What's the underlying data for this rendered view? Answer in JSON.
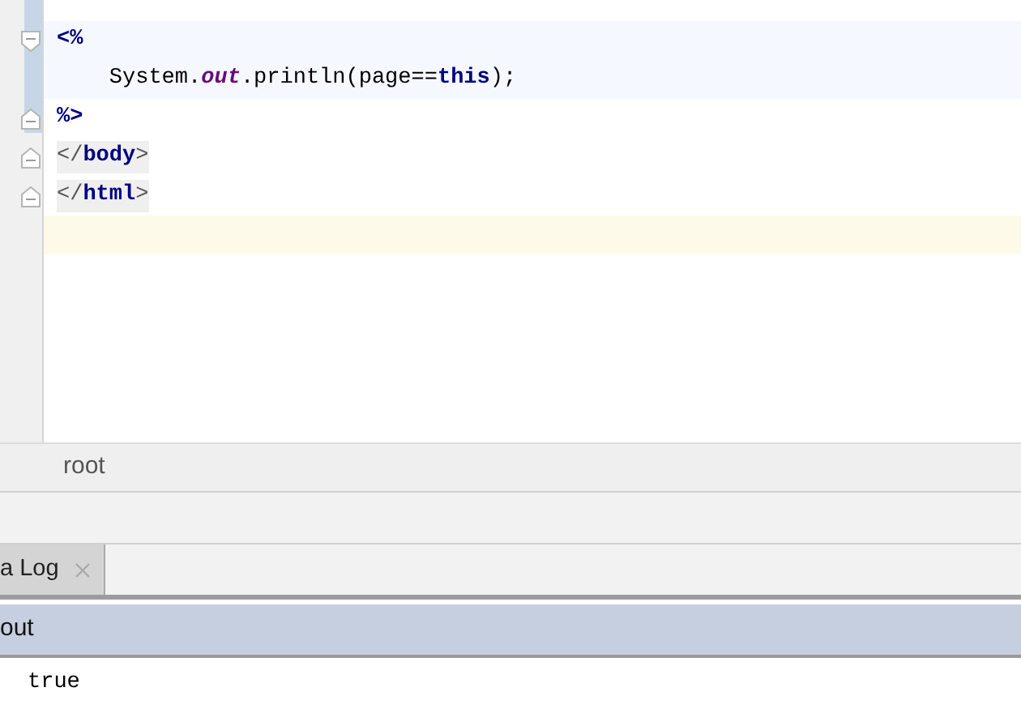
{
  "editor": {
    "lines": [
      {
        "kind": "scriptlet",
        "fold_start": true,
        "fold_end": false,
        "tokens": [
          {
            "text": "<%",
            "kind": "keyword"
          }
        ]
      },
      {
        "kind": "scriptlet",
        "fold_start": false,
        "fold_end": false,
        "tokens": [
          {
            "text": "    System.",
            "kind": "plain"
          },
          {
            "text": "out",
            "kind": "field"
          },
          {
            "text": ".println(page==",
            "kind": "plain"
          },
          {
            "text": "this",
            "kind": "keyword"
          },
          {
            "text": ");",
            "kind": "plain"
          }
        ]
      },
      {
        "kind": "plain",
        "fold_start": false,
        "fold_end": true,
        "tokens": [
          {
            "text": "%>",
            "kind": "keyword"
          }
        ]
      },
      {
        "kind": "tag",
        "fold_start": false,
        "fold_end": true,
        "tokens": [
          {
            "text": "</",
            "kind": "bracket"
          },
          {
            "text": "body",
            "kind": "keyword"
          },
          {
            "text": ">",
            "kind": "bracket"
          }
        ]
      },
      {
        "kind": "tag",
        "fold_start": false,
        "fold_end": true,
        "tokens": [
          {
            "text": "</",
            "kind": "bracket"
          },
          {
            "text": "html",
            "kind": "keyword"
          },
          {
            "text": ">",
            "kind": "bracket"
          }
        ]
      },
      {
        "kind": "current",
        "fold_start": false,
        "fold_end": false
      }
    ]
  },
  "breadcrumb": "root",
  "tool_tabs": [
    {
      "label": "a Log",
      "selected": true
    }
  ],
  "console": {
    "header": "out",
    "output": "true"
  }
}
